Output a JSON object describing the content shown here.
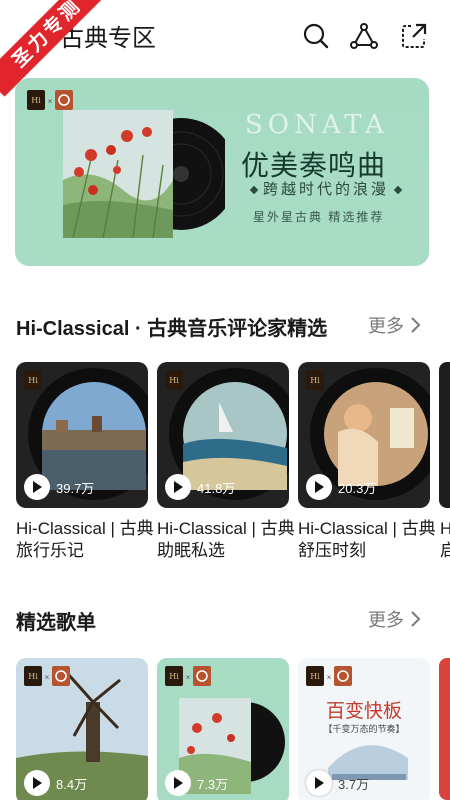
{
  "corner_badge": "圣力专测",
  "header": {
    "title": "古典专区",
    "icons": [
      "search-icon",
      "share-icon",
      "external-link-icon"
    ]
  },
  "banner": {
    "logo_left": "Hi",
    "logo_mark": "×",
    "watermark": "SONATA",
    "headline": "优美奏鸣曲",
    "tagline": "跨越时代的浪漫",
    "subline": "星外星古典  精选推荐"
  },
  "section1": {
    "title": "Hi-Classical · 古典音乐评论家精选",
    "more": "更多",
    "items": [
      {
        "line1": "Hi-Classical | 古典",
        "line2": "旅行乐记",
        "plays": "39.7万"
      },
      {
        "line1": "Hi-Classical | 古典",
        "line2": "助眠私选",
        "plays": "41.8万"
      },
      {
        "line1": "Hi-Classical | 古典",
        "line2": "舒压时刻",
        "plays": "20.3万"
      }
    ],
    "partial_item": {
      "line1": "Hi",
      "line2": "启"
    }
  },
  "section2": {
    "title": "精选歌单",
    "more": "更多",
    "items": [
      {
        "plays": "8.4万"
      },
      {
        "plays": "7.3万"
      },
      {
        "plays": "3.7万",
        "cover_title": "百变快板",
        "cover_sub": "【千变万态的节奏】"
      }
    ]
  },
  "colors": {
    "accent_badge": "#e0262c",
    "banner_bg": "#a8dbc4",
    "text_primary": "#1a1a1a",
    "text_muted": "#7a7a7a"
  }
}
